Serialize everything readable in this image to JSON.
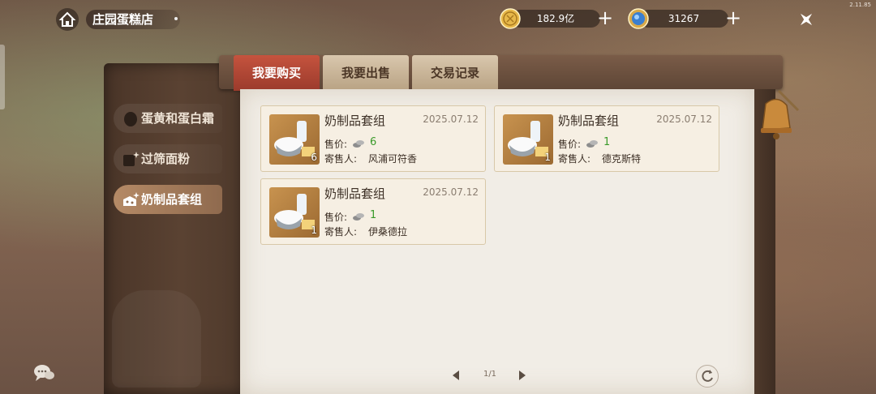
{
  "version": "2.11.85",
  "header": {
    "title": "庄园蛋糕店"
  },
  "currencies": [
    {
      "name": "gold-coin",
      "value": "182.9亿",
      "add": "+"
    },
    {
      "name": "diamond",
      "value": "31267",
      "add": "+"
    }
  ],
  "tabs": [
    {
      "label": "我要购买",
      "active": true
    },
    {
      "label": "我要出售",
      "active": false
    },
    {
      "label": "交易记录",
      "active": false
    }
  ],
  "categories": [
    {
      "label": "蛋黄和蛋白霜",
      "icon": "egg-icon",
      "active": false
    },
    {
      "label": "过筛面粉",
      "icon": "flour-icon",
      "active": false
    },
    {
      "label": "奶制品套组",
      "icon": "dairy-icon",
      "active": true
    }
  ],
  "listings": [
    {
      "name": "奶制品套组",
      "date": "2025.07.12",
      "qty": "6",
      "price_label": "售价:",
      "price": "6",
      "seller_label": "寄售人:",
      "seller": "风浦可符香"
    },
    {
      "name": "奶制品套组",
      "date": "2025.07.12",
      "qty": "1",
      "price_label": "售价:",
      "price": "1",
      "seller_label": "寄售人:",
      "seller": "德克斯特"
    },
    {
      "name": "奶制品套组",
      "date": "2025.07.12",
      "qty": "1",
      "price_label": "售价:",
      "price": "1",
      "seller_label": "寄售人:",
      "seller": "伊桑德拉"
    }
  ],
  "pagination": {
    "page": "1/1"
  },
  "colors": {
    "active_tab": "#b5442f",
    "price_green": "#3a9a2a",
    "paper": "#f1ede6"
  }
}
